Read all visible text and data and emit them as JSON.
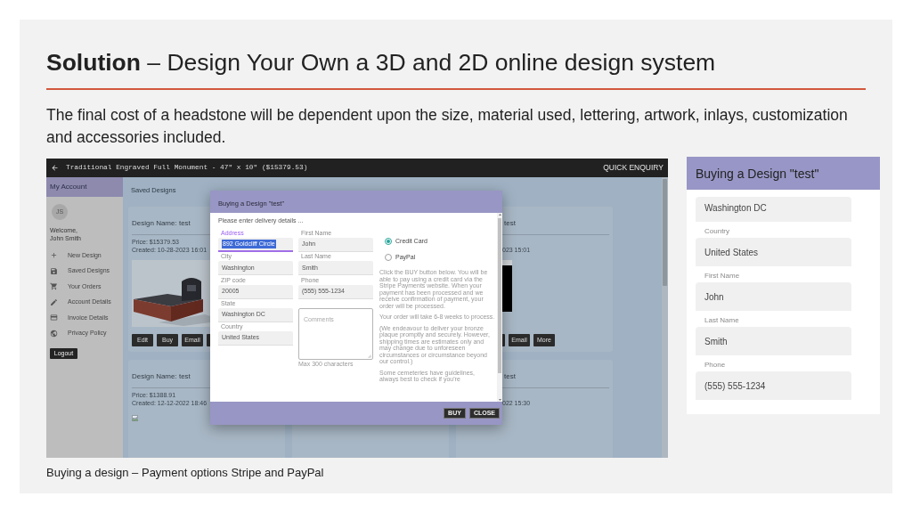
{
  "slide": {
    "title": "**Solution** – Design Your Own a 3D and 2D online design system",
    "description": "The final cost of a headstone will be dependent upon the size, material used, lettering, artwork, inlays, customization and accessories included.",
    "caption": "Buying a design – Payment options Stripe and PayPal"
  },
  "screenshot": {
    "app_bar": {
      "title": "Traditional Engraved Full Monument - 47\" x 10\" ($15379.53)",
      "action": "QUICK ENQUIRY"
    },
    "sidebar": {
      "header": "My Account",
      "avatar": "JS",
      "greeting": "Welcome,",
      "user_name": "John Smith",
      "items": [
        {
          "label": "New Design"
        },
        {
          "label": "Saved Designs"
        },
        {
          "label": "Your Orders"
        },
        {
          "label": "Account Details"
        },
        {
          "label": "Invoice Details"
        },
        {
          "label": "Privacy Policy"
        }
      ],
      "logout": "Logout"
    },
    "main": {
      "heading": "Saved Designs",
      "card_rows": [
        [
          {
            "kind": "model_preview",
            "name": "Design Name: test",
            "price": "Price: $15379.53",
            "created": "Created: 10-28-2023 16:01",
            "buttons": [
              "Edit",
              "Buy",
              "Email"
            ],
            "covered_button": true
          },
          {
            "kind": "photo_preview",
            "name": "test",
            "created": "023 15:01",
            "buttons": [
              "Email",
              "More"
            ],
            "covered_button": true
          }
        ],
        [
          {
            "kind": "missing_image",
            "name": "Design Name: test",
            "price": "Price: $1388.91",
            "created": "Created: 12-12-2022 18:46",
            "covered_button": false
          },
          {
            "kind": "no_image",
            "name": "test",
            "created": "022 15:30",
            "covered_button": false
          }
        ]
      ]
    },
    "dialog": {
      "title": "Buying a Design \"test\"",
      "intro": "Please enter delivery details ...",
      "address_fields": [
        {
          "label": "Address",
          "value": "892 Goldcliff Circle",
          "focused": true
        },
        {
          "label": "City",
          "value": "Washington",
          "focused": false
        },
        {
          "label": "ZIP code",
          "value": "20005",
          "focused": false
        },
        {
          "label": "State",
          "value": "Washington DC",
          "focused": false
        },
        {
          "label": "Country",
          "value": "United States",
          "focused": false
        }
      ],
      "contact_fields": [
        {
          "label": "First Name",
          "value": "John",
          "focused": false
        },
        {
          "label": "Last Name",
          "value": "Smith",
          "focused": false
        },
        {
          "label": "Phone",
          "value": "(555) 555-1234",
          "focused": false
        }
      ],
      "comments": {
        "placeholder": "Comments",
        "hint": "Max 300 characters"
      },
      "payment_methods": [
        {
          "label": "Credit Card",
          "selected": true
        },
        {
          "label": "PayPal",
          "selected": false
        }
      ],
      "notes": [
        "Click the BUY button below. You will be able to pay using a credit card via the Stripe Payments website. When your payment has been processed and we receive confirmation of payment, your order will be processed.",
        "Your order will take 6-8 weeks to process.",
        "(We endeavour to deliver your bronze plaque promptly and securely. However, shipping times are estimates only and may change due to unforeseen circumstances or circumstance beyond our control.)",
        "Some cemeteries have guidelines, always best to check if you're"
      ],
      "buttons": [
        "BUY",
        "CLOSE"
      ]
    }
  },
  "side_panel": {
    "title": "Buying a Design \"test\"",
    "fields": [
      {
        "value": "Washington DC"
      },
      {
        "label": "Country",
        "value": "United States"
      },
      {
        "label": "First Name",
        "value": "John"
      },
      {
        "label": "Last Name",
        "value": "Smith"
      },
      {
        "label": "Phone",
        "value": "(555) 555-1234"
      }
    ]
  }
}
